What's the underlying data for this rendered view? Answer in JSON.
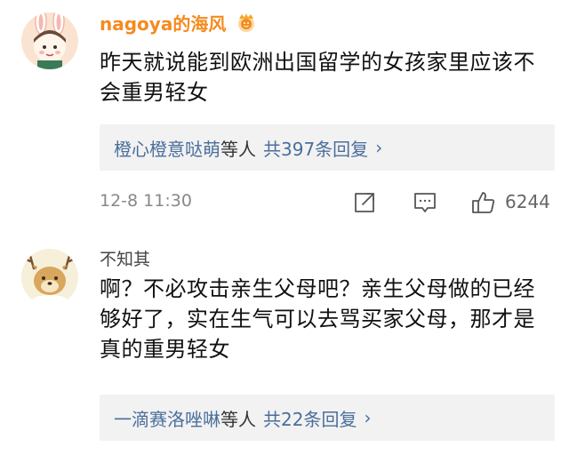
{
  "comments": [
    {
      "username": "nagoya的海风",
      "text": "昨天就说能到欧洲出国留学的女孩家里应该不会重男轻女",
      "replies": {
        "names": "橙心橙意哒萌",
        "deng": "等人",
        "count_label": "共397条回复",
        "chevron": "›"
      },
      "timestamp": "12-8 11:30",
      "like_count": "6244"
    },
    {
      "username": "不知其",
      "text": "啊？不必攻击亲生父母吧？亲生父母做的已经够好了，实在生气可以去骂买家父母，那才是真的重男轻女",
      "replies": {
        "names": "一滴赛洛唑啉",
        "deng": "等人",
        "count_label": "共22条回复",
        "chevron": "›"
      }
    }
  ],
  "colors": {
    "username_vip": "#f48b1f",
    "link_blue": "#4a6f9c",
    "reply_bg": "#f2f2f2",
    "meta_gray": "#888888"
  },
  "icons": {
    "vip_badge": "vip-crown-badge-icon",
    "share": "share-icon",
    "comment": "comment-icon",
    "like": "like-thumb-icon"
  }
}
